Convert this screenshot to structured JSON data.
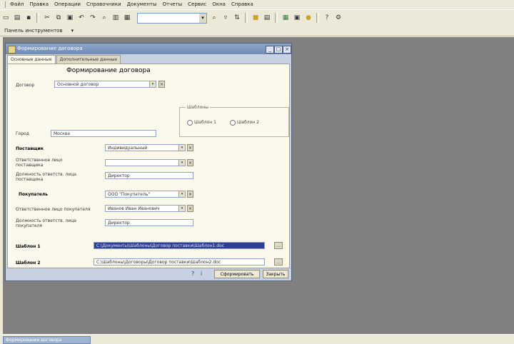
{
  "menu": [
    "Файл",
    "Правка",
    "Операции",
    "Справочники",
    "Документы",
    "Отчеты",
    "Сервис",
    "Окна",
    "Справка"
  ],
  "panel": {
    "tab": "Панель инструментов"
  },
  "status": {
    "task": "Формирование договора"
  },
  "dialog": {
    "title": "Формирование договора",
    "tabs": [
      "Основные данные",
      "Дополнительные данные"
    ],
    "heading": "Формирование договора",
    "contract_label": "Договор",
    "contract_value": "Основной договор",
    "city_label": "Город",
    "city_value": "Москва",
    "group_title": "Шаблоны",
    "radio1": "Шаблон 1",
    "radio2": "Шаблон 2",
    "supplier_label": "Поставщик",
    "supplier_value": "Индивидуальный",
    "rep_supplier_label": "Ответственное лицо поставщика",
    "rep_supplier_value": "",
    "pos_supplier_label": "Должность ответств. лица поставщика",
    "pos_supplier_value": "Директор",
    "buyer_label": "Покупатель",
    "buyer_value": "ООО \"Покупатель\"",
    "rep_buyer_label": "Ответственное лицо покупателя",
    "rep_buyer_value": "Иванов Иван Иванович",
    "pos_buyer_label": "Должность ответств. лица покупателя",
    "pos_buyer_value": "Директор",
    "tpl1_label": "Шаблон 1",
    "tpl1_value": "C:\\Документы\\Шаблоны\\Договор поставки\\Шаблон1.doc",
    "tpl2_label": "Шаблон 2",
    "tpl2_value": "C:\\Шаблоны\\Договоры\\Договор поставки\\Шаблон2.doc",
    "btn_ok": "Сформировать",
    "btn_close": "Закрыть"
  }
}
